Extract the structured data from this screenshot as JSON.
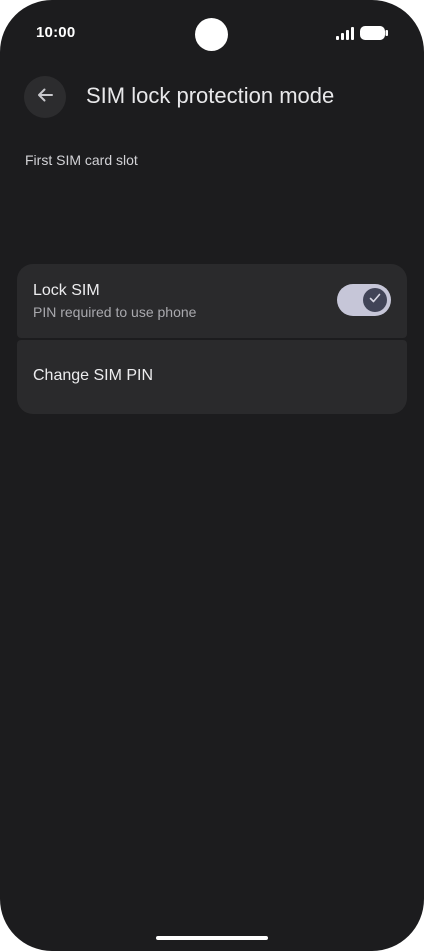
{
  "status_bar": {
    "time": "10:00",
    "signal_icon": "signal-icon",
    "battery_icon": "battery-icon"
  },
  "app_bar": {
    "back_icon": "arrow-back-icon",
    "title": "SIM lock protection mode"
  },
  "section": {
    "label": "First SIM card slot"
  },
  "settings": {
    "lock_sim": {
      "title": "Lock SIM",
      "subtitle": "PIN required to use phone",
      "toggle_on": true,
      "toggle_icon": "check-icon"
    },
    "change_pin": {
      "title": "Change SIM PIN"
    }
  },
  "colors": {
    "background": "#1c1c1e",
    "card": "#2a2a2c",
    "toggle_track": "#c6c6d8",
    "toggle_thumb": "#414457"
  }
}
